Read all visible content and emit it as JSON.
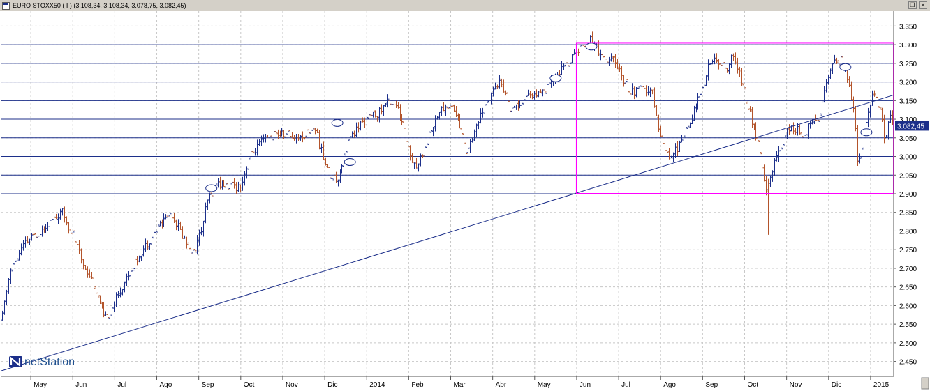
{
  "window": {
    "title": "EURO STOXX50 ( I ) (3.108,34, 3.108,34, 3.078,75, 3.082,45)",
    "restore_icon": "restore-icon",
    "close_icon": "close-icon"
  },
  "brand": {
    "logo_text": "netStation"
  },
  "colors": {
    "background": "#ffffff",
    "up_bar": "#1c2f8a",
    "down_bar": "#b3542b",
    "grid": "#c8c8c8",
    "hline": "#1c2f8a",
    "box": "#ff00ff",
    "price_tag": "#1c2f8a"
  },
  "chart_data": {
    "type": "ohlc",
    "instrument": "EURO STOXX50",
    "last_price_label": "3.082,45",
    "y_axis": {
      "ylim": [
        2410,
        3390
      ],
      "tick_values": [
        2450,
        2500,
        2550,
        2600,
        2650,
        2700,
        2750,
        2800,
        2850,
        2900,
        2950,
        3000,
        3050,
        3100,
        3150,
        3200,
        3250,
        3300,
        3350
      ],
      "tick_labels": [
        "2.450",
        "2.500",
        "2.550",
        "2.600",
        "2.650",
        "2.700",
        "2.750",
        "2.800",
        "2.850",
        "2.900",
        "2.950",
        "3.000",
        "3.050",
        "3.100",
        "3.150",
        "3.200",
        "3.250",
        "3.300",
        "3.350"
      ]
    },
    "x_axis": {
      "labels": [
        "May",
        "Jun",
        "Jul",
        "Ago",
        "Sep",
        "Oct",
        "Nov",
        "Dic",
        "2014",
        "Feb",
        "Mar",
        "Abr",
        "May",
        "Jun",
        "Jul",
        "Ago",
        "Sep",
        "Oct",
        "Nov",
        "Dic",
        "2015"
      ],
      "month_index": [
        0,
        1,
        2,
        3,
        4,
        5,
        6,
        7,
        8,
        9,
        10,
        11,
        12,
        13,
        14,
        15,
        16,
        17,
        18,
        19,
        20
      ]
    },
    "x_range_months": [
      -0.7,
      20.55
    ],
    "grid": true,
    "anchors": [
      [
        -0.7,
        2560
      ],
      [
        -0.5,
        2690
      ],
      [
        -0.2,
        2760
      ],
      [
        0.2,
        2800
      ],
      [
        0.5,
        2830
      ],
      [
        0.75,
        2850
      ],
      [
        1.0,
        2790
      ],
      [
        1.2,
        2720
      ],
      [
        1.45,
        2670
      ],
      [
        1.65,
        2600
      ],
      [
        1.75,
        2560
      ],
      [
        2.0,
        2610
      ],
      [
        2.3,
        2680
      ],
      [
        2.6,
        2740
      ],
      [
        2.9,
        2790
      ],
      [
        3.15,
        2830
      ],
      [
        3.35,
        2850
      ],
      [
        3.6,
        2790
      ],
      [
        3.85,
        2740
      ],
      [
        4.05,
        2800
      ],
      [
        4.2,
        2880
      ],
      [
        4.4,
        2930
      ],
      [
        4.7,
        2920
      ],
      [
        5.0,
        2920
      ],
      [
        5.2,
        3000
      ],
      [
        5.5,
        3040
      ],
      [
        5.8,
        3060
      ],
      [
        6.1,
        3060
      ],
      [
        6.4,
        3050
      ],
      [
        6.75,
        3080
      ],
      [
        6.95,
        3000
      ],
      [
        7.1,
        2950
      ],
      [
        7.3,
        2940
      ],
      [
        7.55,
        3040
      ],
      [
        7.8,
        3080
      ],
      [
        8.0,
        3100
      ],
      [
        8.3,
        3120
      ],
      [
        8.5,
        3150
      ],
      [
        8.7,
        3140
      ],
      [
        8.9,
        3060
      ],
      [
        9.05,
        3000
      ],
      [
        9.2,
        2970
      ],
      [
        9.45,
        3050
      ],
      [
        9.7,
        3120
      ],
      [
        10.0,
        3140
      ],
      [
        10.2,
        3090
      ],
      [
        10.35,
        3010
      ],
      [
        10.6,
        3080
      ],
      [
        10.85,
        3140
      ],
      [
        11.0,
        3190
      ],
      [
        11.2,
        3200
      ],
      [
        11.4,
        3130
      ],
      [
        11.6,
        3140
      ],
      [
        11.9,
        3170
      ],
      [
        12.1,
        3160
      ],
      [
        12.4,
        3200
      ],
      [
        12.6,
        3230
      ],
      [
        12.85,
        3260
      ],
      [
        13.05,
        3290
      ],
      [
        13.3,
        3310
      ],
      [
        13.5,
        3290
      ],
      [
        13.7,
        3250
      ],
      [
        13.9,
        3260
      ],
      [
        14.1,
        3210
      ],
      [
        14.25,
        3170
      ],
      [
        14.5,
        3180
      ],
      [
        14.8,
        3170
      ],
      [
        15.0,
        3050
      ],
      [
        15.2,
        3000
      ],
      [
        15.45,
        3030
      ],
      [
        15.7,
        3100
      ],
      [
        15.95,
        3170
      ],
      [
        16.15,
        3250
      ],
      [
        16.35,
        3260
      ],
      [
        16.55,
        3230
      ],
      [
        16.7,
        3270
      ],
      [
        16.85,
        3230
      ],
      [
        17.0,
        3160
      ],
      [
        17.15,
        3100
      ],
      [
        17.35,
        3020
      ],
      [
        17.5,
        2900
      ],
      [
        17.65,
        2960
      ],
      [
        17.85,
        3030
      ],
      [
        18.1,
        3080
      ],
      [
        18.4,
        3060
      ],
      [
        18.6,
        3100
      ],
      [
        18.8,
        3110
      ],
      [
        18.95,
        3210
      ],
      [
        19.15,
        3250
      ],
      [
        19.3,
        3260
      ],
      [
        19.45,
        3200
      ],
      [
        19.6,
        3120
      ],
      [
        19.7,
        2970
      ],
      [
        19.85,
        3080
      ],
      [
        20.05,
        3170
      ],
      [
        20.2,
        3140
      ],
      [
        20.35,
        3040
      ],
      [
        20.45,
        3120
      ],
      [
        20.52,
        3085
      ]
    ],
    "spikes": [
      [
        17.55,
        2790
      ],
      [
        19.72,
        2920
      ]
    ],
    "horizontal_levels": [
      3000,
      2950,
      2900,
      3050,
      3100,
      3150,
      3200,
      3250,
      3300
    ],
    "trendline": {
      "start": [
        -0.7,
        2425
      ],
      "end": [
        20.55,
        3165
      ]
    },
    "range_box": {
      "x": [
        13.0,
        20.55
      ],
      "y": [
        2900,
        3305
      ]
    },
    "gap_markers": [
      [
        4.3,
        2915
      ],
      [
        7.3,
        3090
      ],
      [
        7.6,
        2985
      ],
      [
        12.5,
        3210
      ],
      [
        13.35,
        3295
      ],
      [
        19.4,
        3240
      ],
      [
        19.9,
        3065
      ]
    ]
  }
}
